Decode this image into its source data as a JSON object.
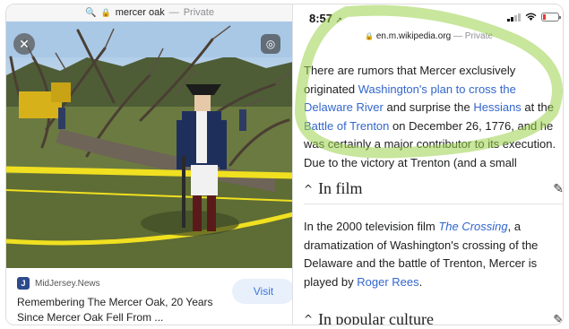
{
  "left_pane": {
    "url_bar": {
      "lock": "🔒",
      "query": "mercer oak",
      "separator": "—",
      "status": "Private"
    },
    "source": {
      "logo_letter": "J",
      "name": "MidJersey.News",
      "title": "Remembering The Mercer Oak, 20 Years Since Mercer Oak Fell From ...",
      "visit_label": "Visit"
    }
  },
  "right_pane": {
    "status": {
      "time": "8:57",
      "location_glyph": "➚"
    },
    "url_bar": {
      "lock": "🔒",
      "domain": "en.m.wikipedia.org",
      "separator": "—",
      "status": "Private"
    },
    "article": {
      "p1_a": "There are rumors that Mercer exclusively originated ",
      "link_plan": "Washington's plan to cross the Delaware River",
      "p1_b": " and surprise the ",
      "link_hessians": "Hessians",
      "p1_c": " at the ",
      "link_trenton": "Battle of Trenton",
      "p1_d": " on December 26, 1776, and he was certainly a major contributor to its execution. Due to the victory at Trenton (and a small"
    },
    "sections": [
      {
        "chevron": "^",
        "title": "In film",
        "edit_icon": "✎"
      },
      {
        "chevron": "^",
        "title": "In popular culture",
        "edit_icon": "✎"
      }
    ],
    "film": {
      "a": "In the 2000 television film ",
      "link_crossing": "The Crossing",
      "b": ", a dramatization of Washington's crossing of the Delaware and the battle of Trenton, Mercer is played by ",
      "link_rees": "Roger Rees",
      "c": "."
    }
  },
  "colors": {
    "link": "#3366cc",
    "highlight": "#9bd24a",
    "visit_bg": "#e8f0fb",
    "visit_text": "#3b78d8"
  }
}
